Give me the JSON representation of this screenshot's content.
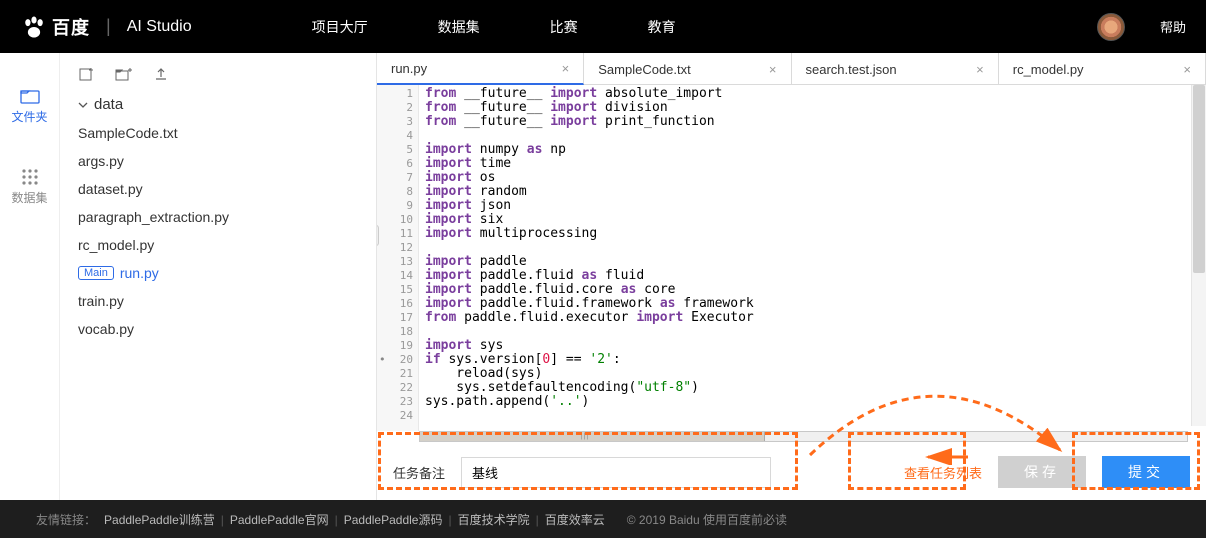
{
  "brand": {
    "baidu_text": "百度",
    "studio_text": "AI Studio"
  },
  "nav": [
    "项目大厅",
    "数据集",
    "比赛",
    "教育"
  ],
  "help_label": "帮助",
  "rails": [
    {
      "id": "files",
      "label": "文件夹"
    },
    {
      "id": "datasets",
      "label": "数据集"
    }
  ],
  "tree": {
    "folder_name": "data",
    "files": [
      "SampleCode.txt",
      "args.py",
      "dataset.py",
      "paragraph_extraction.py",
      "rc_model.py",
      "run.py",
      "train.py",
      "vocab.py"
    ],
    "active_file": "run.py",
    "main_badge": "Main"
  },
  "tabs": [
    {
      "name": "run.py",
      "active": true
    },
    {
      "name": "SampleCode.txt",
      "active": false
    },
    {
      "name": "search.test.json",
      "active": false
    },
    {
      "name": "rc_model.py",
      "active": false
    }
  ],
  "code_lines": [
    {
      "n": 1,
      "html": "<span class='kw-from'>from</span> __future__ <span class='kw-import'>import</span> absolute_import"
    },
    {
      "n": 2,
      "html": "<span class='kw-from'>from</span> __future__ <span class='kw-import'>import</span> division"
    },
    {
      "n": 3,
      "html": "<span class='kw-from'>from</span> __future__ <span class='kw-import'>import</span> print_function"
    },
    {
      "n": 4,
      "html": ""
    },
    {
      "n": 5,
      "html": "<span class='kw-import'>import</span> numpy <span class='kw-as'>as</span> np"
    },
    {
      "n": 6,
      "html": "<span class='kw-import'>import</span> time"
    },
    {
      "n": 7,
      "html": "<span class='kw-import'>import</span> os"
    },
    {
      "n": 8,
      "html": "<span class='kw-import'>import</span> random"
    },
    {
      "n": 9,
      "html": "<span class='kw-import'>import</span> json"
    },
    {
      "n": 10,
      "html": "<span class='kw-import'>import</span> six"
    },
    {
      "n": 11,
      "html": "<span class='kw-import'>import</span> multiprocessing"
    },
    {
      "n": 12,
      "html": ""
    },
    {
      "n": 13,
      "html": "<span class='kw-import'>import</span> paddle"
    },
    {
      "n": 14,
      "html": "<span class='kw-import'>import</span> paddle.fluid <span class='kw-as'>as</span> fluid"
    },
    {
      "n": 15,
      "html": "<span class='kw-import'>import</span> paddle.fluid.core <span class='kw-as'>as</span> core"
    },
    {
      "n": 16,
      "html": "<span class='kw-import'>import</span> paddle.fluid.framework <span class='kw-as'>as</span> framework"
    },
    {
      "n": 17,
      "html": "<span class='kw-from'>from</span> paddle.fluid.executor <span class='kw-import'>import</span> Executor"
    },
    {
      "n": 18,
      "html": ""
    },
    {
      "n": 19,
      "html": "<span class='kw-import'>import</span> sys"
    },
    {
      "n": 20,
      "marked": true,
      "html": "<span class='kw-if'>if</span> sys.version[<span class='num'>0</span>] == <span class='str'>'2'</span>:"
    },
    {
      "n": 21,
      "html": "    reload(sys)"
    },
    {
      "n": 22,
      "html": "    sys.setdefaultencoding(<span class='str'>\"utf-8\"</span>)"
    },
    {
      "n": 23,
      "html": "sys.path.append(<span class='str'>'..'</span>)"
    },
    {
      "n": 24,
      "html": ""
    }
  ],
  "bottom": {
    "task_label": "任务备注",
    "task_value": "基线",
    "view_tasks": "查看任务列表",
    "save_label": "保存",
    "submit_label": "提交"
  },
  "footer": {
    "prefix": "友情链接：",
    "links": [
      "PaddlePaddle训练营",
      "PaddlePaddle官网",
      "PaddlePaddle源码",
      "百度技术学院",
      "百度效率云"
    ],
    "copyright": "© 2019 Baidu 使用百度前必读"
  }
}
